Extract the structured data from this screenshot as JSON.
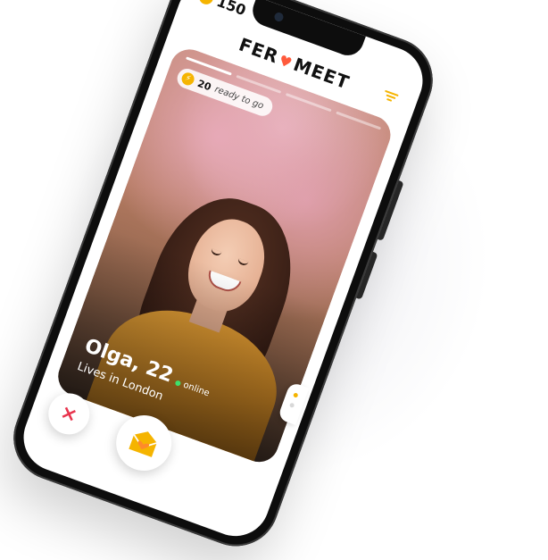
{
  "status_bar": {
    "coin_icon": "bolt-coin-icon",
    "coins_count": "150"
  },
  "header": {
    "logo_left": "FER",
    "logo_right": "MEET",
    "filter_icon": "filter-icon"
  },
  "card": {
    "ready_count": "20",
    "ready_text": "ready to go",
    "name": "Olga, 22",
    "status": "online",
    "location": "Lives in London"
  },
  "actions": {
    "dislike_symbol": "×",
    "like_icon": "envelope-heart-icon"
  },
  "colors": {
    "accent": "#f5b400",
    "brand_heart": "#ff5a3c",
    "dislike": "#e8344d",
    "online": "#3ee06b"
  }
}
